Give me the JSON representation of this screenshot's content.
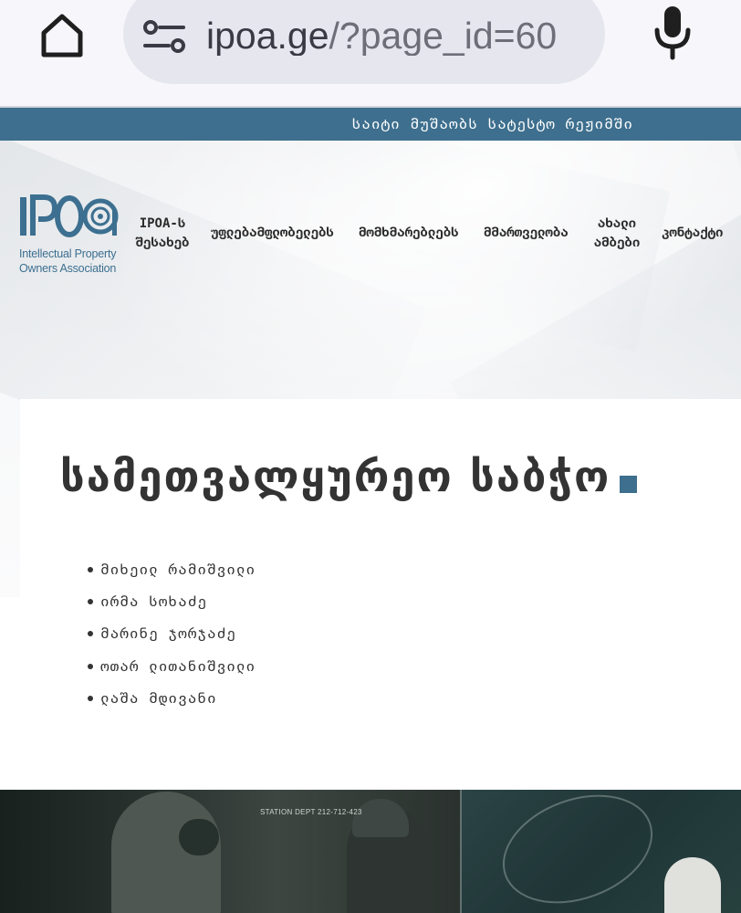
{
  "browser": {
    "url_prefix": "ipoa.ge",
    "url_rest": "/?page_id=60",
    "icons": {
      "home": "home-icon",
      "site_settings": "tune-icon",
      "mic": "mic-icon"
    }
  },
  "banner": {
    "text": "საიტი მუშაობს სატესტო რეჟიმში",
    "color": "#3e6f8e"
  },
  "logo": {
    "wordmark": "IPOA",
    "line1": "Intellectual Property",
    "line2": "Owners Association",
    "color": "#3c6f90"
  },
  "nav": {
    "items": [
      {
        "line1": "IPOA-ს",
        "line2": "შესახებ"
      },
      {
        "line1": "უფლებამფლობელებს",
        "line2": ""
      },
      {
        "line1": "მომხმარებლებს",
        "line2": ""
      },
      {
        "line1": "მმართველობა",
        "line2": ""
      },
      {
        "line1": "ახალი",
        "line2": "ამბები"
      },
      {
        "line1": "კონტაქტი",
        "line2": ""
      }
    ]
  },
  "page": {
    "title": "სამეთვალყურეო საბჭო",
    "members": [
      "მიხეილ რამიშვილი",
      "ირმა სოხაძე",
      "მარინე ჯორჯაძე",
      "ოთარ ლითანიშვილი",
      "ლაშა მდივანი"
    ]
  },
  "photo": {
    "sign_text": "STATION DEPT 212-712-423"
  }
}
